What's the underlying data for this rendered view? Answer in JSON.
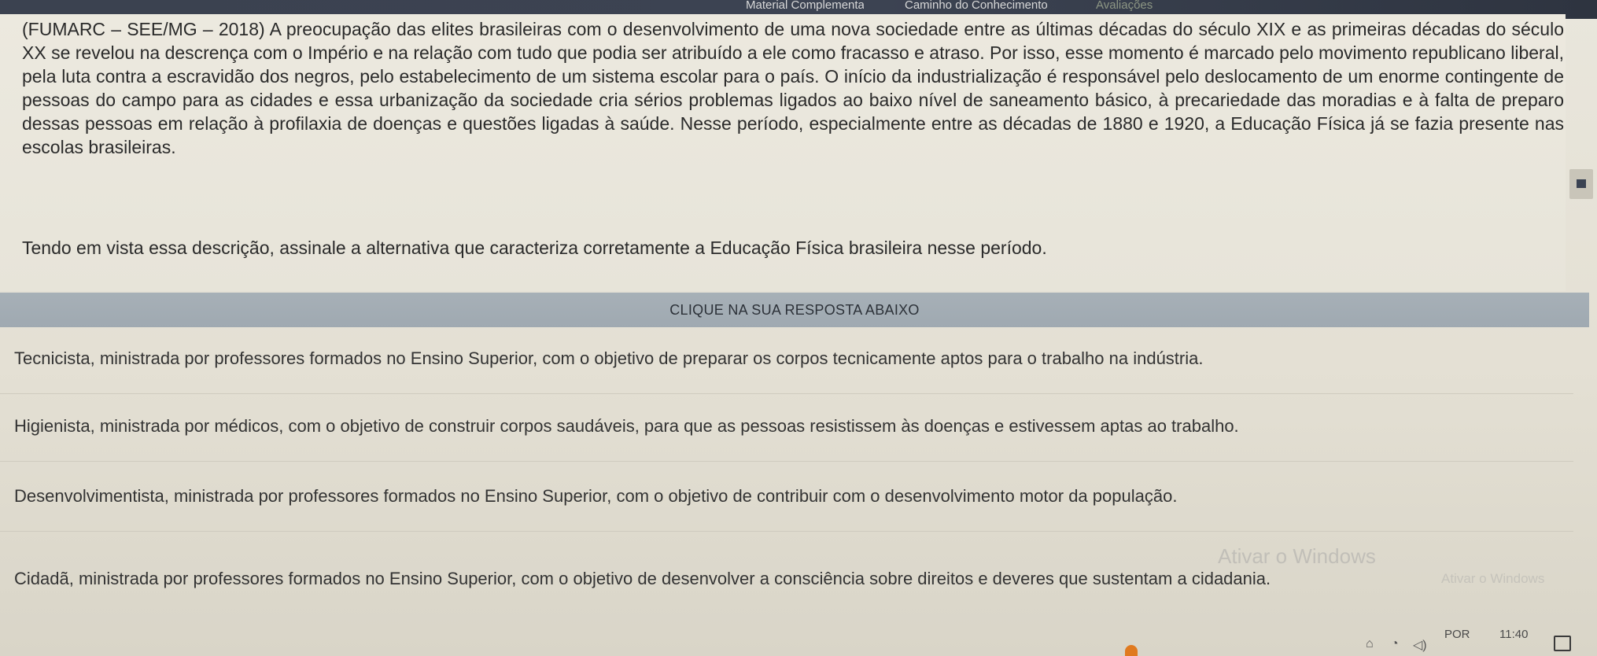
{
  "topbar": {
    "material": "Material Complementar",
    "caminho": "Caminho do Conhecimento",
    "avaliacoes": "Avaliações"
  },
  "question": {
    "text": "(FUMARC – SEE/MG – 2018) A preocupação das elites brasileiras com o desenvolvimento de uma nova sociedade entre as últimas décadas do século XIX e as primeiras décadas do século XX se revelou na descrença com o Império e na relação com tudo que podia ser atribuído a ele como fracasso e atraso. Por isso, esse momento é marcado pelo movimento republicano liberal, pela luta contra a escravidão dos negros, pelo estabelecimento de um sistema escolar para o país. O início da industrialização é responsável pelo deslocamento de um enorme contingente de pessoas do campo para as cidades e essa urbanização da sociedade cria sérios problemas ligados ao baixo nível de saneamento básico, à precariedade das moradias e à falta de preparo dessas pessoas em relação à profilaxia de doenças e questões ligadas à saúde. Nesse período, especialmente entre as décadas de 1880 e 1920, a Educação Física já se fazia presente nas escolas brasileiras.",
    "prompt": "Tendo em vista essa descrição, assinale a alternativa que caracteriza corretamente a Educação Física brasileira nesse período."
  },
  "answers": {
    "header": "CLIQUE NA SUA RESPOSTA ABAIXO",
    "options": [
      "Tecnicista, ministrada por professores formados no Ensino Superior, com o objetivo de preparar os corpos tecnicamente aptos para o trabalho na indústria.",
      "Higienista, ministrada por médicos, com o objetivo de construir corpos saudáveis, para que as pessoas resistissem às doenças e estivessem aptas ao trabalho.",
      "Desenvolvimentista, ministrada por professores formados no Ensino Superior, com o objetivo de contribuir com o desenvolvimento motor da população.",
      "Cidadã, ministrada por professores formados no Ensino Superior, com o objetivo de desenvolver a consciência sobre direitos e deveres que sustentam a cidadania."
    ]
  },
  "watermark": {
    "line1": "Ativar o Windows",
    "line2": "Ativar o Windows"
  },
  "taskbar": {
    "language": "POR",
    "time": "11:40",
    "icons": [
      "network-icon",
      "wifi-icon",
      "volume-icon",
      "notification-icon"
    ]
  }
}
